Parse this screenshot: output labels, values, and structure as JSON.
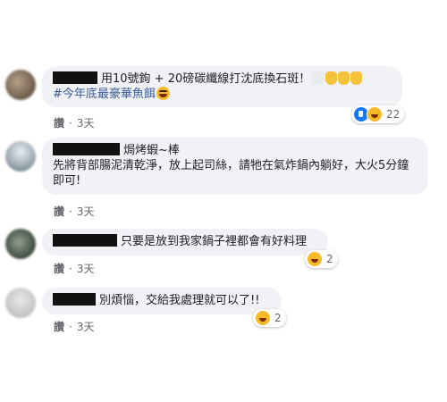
{
  "colors": {
    "bubble": "#f0f2f5",
    "text": "#1c1e21",
    "meta": "#65676b",
    "hashtag": "#385898",
    "like": "#1877f2",
    "haha": "#f7b928"
  },
  "comments": [
    {
      "text": "用10號鉤 + 20磅碳纖線打沈底換石斑！",
      "hashtag": "#今年底最豪華魚餌",
      "emojis": [
        "fishing-reel-emoji",
        "thumbs-up-emoji",
        "thumbs-up-emoji",
        "thumbs-up-emoji",
        "laughing-emoji"
      ],
      "reactions": {
        "icons": [
          "like",
          "haha"
        ],
        "count": "22"
      },
      "like_label": "讚",
      "separator": "·",
      "time": "3天"
    },
    {
      "name": "焗烤蝦~棒",
      "text": "先將背部腸泥清乾淨，放上起司絲，請牠在氣炸鍋內躺好，大火5分鐘即可!",
      "like_label": "讚",
      "separator": "·",
      "time": "3天"
    },
    {
      "text": "只要是放到我家鍋子裡都會有好料理",
      "reactions": {
        "icons": [
          "haha"
        ],
        "count": "2"
      },
      "like_label": "讚",
      "separator": "·",
      "time": "3天"
    },
    {
      "text": "別煩惱，交給我處理就可以了!!",
      "reactions": {
        "icons": [
          "haha"
        ],
        "count": "2"
      },
      "like_label": "讚",
      "separator": "·",
      "time": "3天"
    }
  ]
}
